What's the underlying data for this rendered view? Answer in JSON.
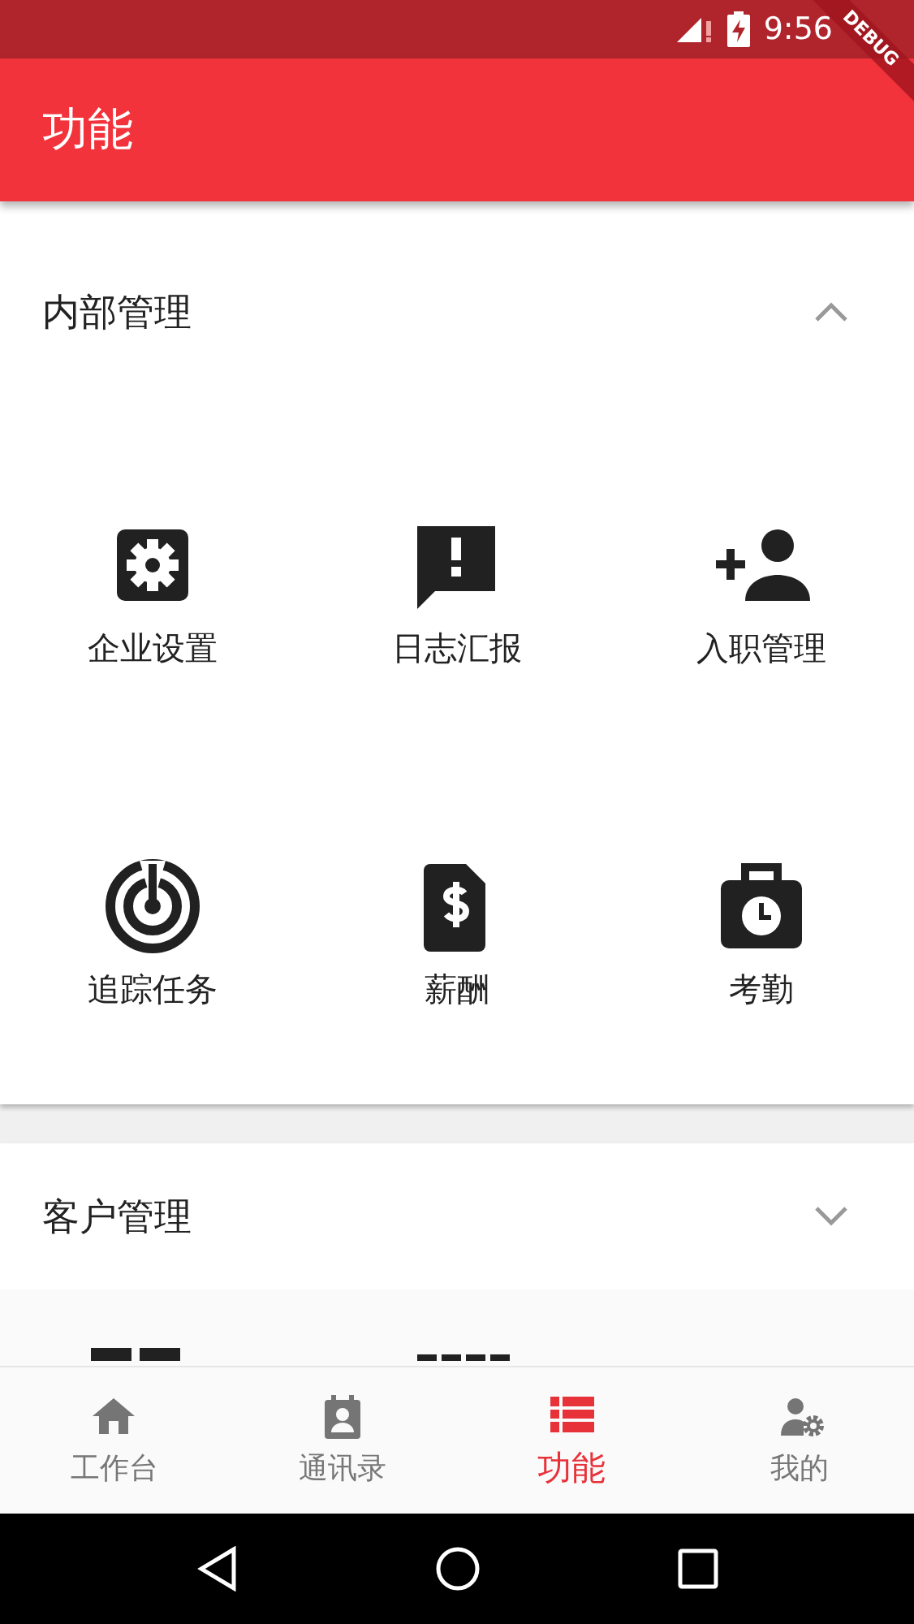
{
  "status_bar": {
    "time": "9:56"
  },
  "debug_banner": {
    "text": "DEBUG"
  },
  "app_bar": {
    "title": "功能"
  },
  "sections": [
    {
      "title": "内部管理",
      "expanded": true,
      "items": [
        {
          "label": "企业设置"
        },
        {
          "label": "日志汇报"
        },
        {
          "label": "入职管理"
        },
        {
          "label": "追踪任务"
        },
        {
          "label": "薪酬"
        },
        {
          "label": "考勤"
        }
      ]
    },
    {
      "title": "客户管理",
      "expanded": false
    }
  ],
  "bottom_nav": [
    {
      "label": "工作台",
      "selected": false
    },
    {
      "label": "通讯录",
      "selected": false
    },
    {
      "label": "功能",
      "selected": true
    },
    {
      "label": "我的",
      "selected": false
    }
  ]
}
